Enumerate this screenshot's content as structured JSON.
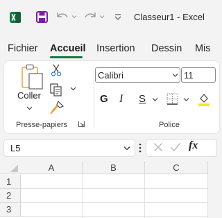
{
  "titlebar": {
    "app_icon": "excel-logo-icon",
    "save_icon": "save-icon",
    "undo_icon": "undo-icon",
    "redo_icon": "redo-icon",
    "customize_icon": "customize-quick-access-icon",
    "title": "Classeur1  -  Excel"
  },
  "tabs": [
    {
      "label": "Fichier"
    },
    {
      "label": "Accueil",
      "active": true
    },
    {
      "label": "Insertion"
    },
    {
      "label": "Dessin"
    },
    {
      "label": "Mis"
    }
  ],
  "ribbon": {
    "clipboard": {
      "paste_label": "Coller",
      "group_label": "Presse-papiers",
      "icons": [
        "paste-icon",
        "cut-icon",
        "copy-icon",
        "format-painter-icon"
      ]
    },
    "font": {
      "font_name": "Calibri",
      "font_size": "11",
      "bold": "G",
      "italic": "I",
      "underline": "S",
      "group_label": "Police",
      "icons": [
        "borders-icon",
        "fill-color-icon"
      ]
    }
  },
  "formula_bar": {
    "name_box": "L5",
    "cancel_icon": "cancel-icon",
    "enter_icon": "enter-icon",
    "fx": "fx"
  },
  "grid": {
    "columns": [
      "A",
      "B",
      "C"
    ],
    "rows": [
      "1",
      "2",
      "3"
    ]
  },
  "colors": {
    "accent": "#107c41",
    "background": "#f3f3f3"
  }
}
